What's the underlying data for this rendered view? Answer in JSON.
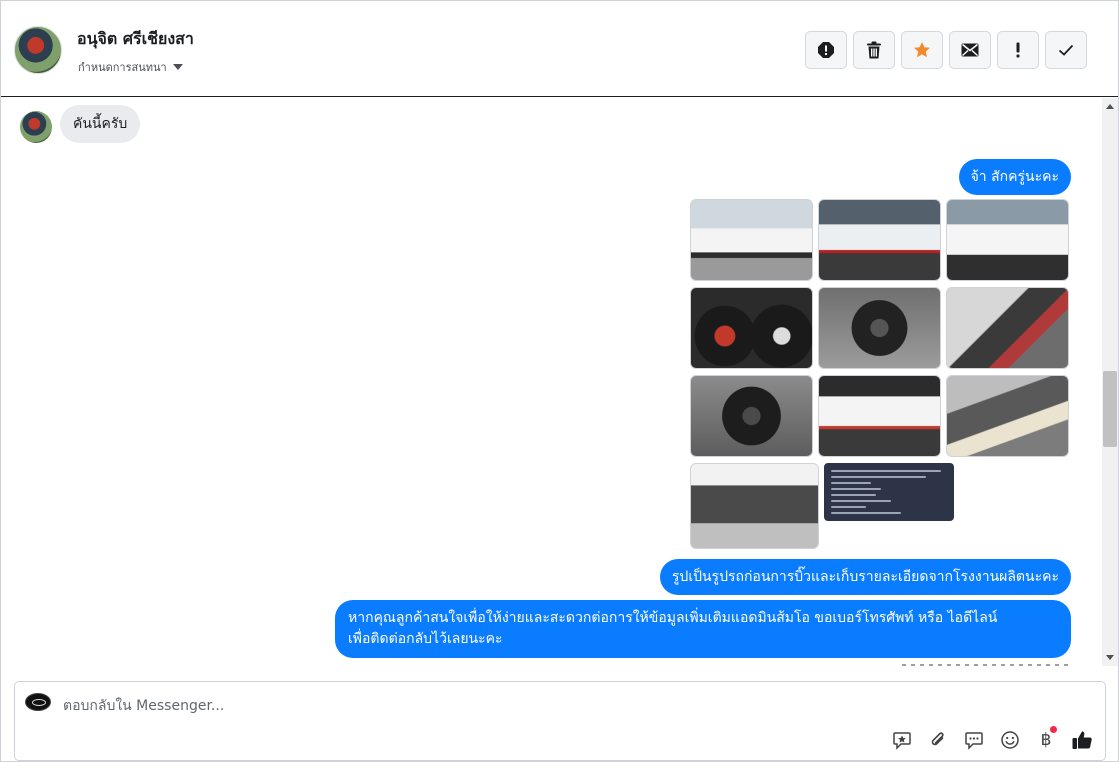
{
  "contact": {
    "name": "อนุจิต ศรีเชียงสา",
    "assign_label": "กำหนดการสนทนา"
  },
  "header_actions": [
    {
      "name": "spam-icon"
    },
    {
      "name": "trash-icon"
    },
    {
      "name": "star-icon",
      "color": "#f28a2e"
    },
    {
      "name": "envelope-icon"
    },
    {
      "name": "exclamation-icon"
    },
    {
      "name": "check-icon"
    }
  ],
  "messages": {
    "incoming_1": "คันนี้ครับ",
    "outgoing_1": "จ้า สักครู่นะคะ",
    "outgoing_2": "รูปเป็นรูปรถก่อนการบิ๊วและเก็บรายละเอียดจากโรงงานผลิตนะคะ",
    "outgoing_3_line1": "หากคุณลูกค้าสนใจเพื่อให้ง่ายและสะดวกต่อการให้ข้อมูลเพิ่มเติมแอดมินส้มโอ ขอเบอร์โทรศัพท์ หรือ ไอดีไลน์",
    "outgoing_3_line2": "เพื่อติดต่อกลับไว้เลยนะคะ"
  },
  "photos": [
    "car-front-white",
    "car-front-white-2",
    "car-front-white-3",
    "dashboard-gauges",
    "steering-wheel",
    "interior-seats",
    "steering-wheel-2",
    "truck-rear",
    "engine-bay",
    "engine-bay-open",
    "registration-document"
  ],
  "composer": {
    "placeholder": "ตอบกลับใน Messenger...",
    "tools": [
      "saved-reply-icon",
      "attach-icon",
      "chat-icon",
      "emoji-icon",
      "baht-icon",
      "like-icon"
    ],
    "baht_symbol": "฿"
  },
  "colors": {
    "outgoing_bubble": "#0a7cff",
    "incoming_bubble": "#e9ebee",
    "notification_dot": "#f0284a"
  }
}
